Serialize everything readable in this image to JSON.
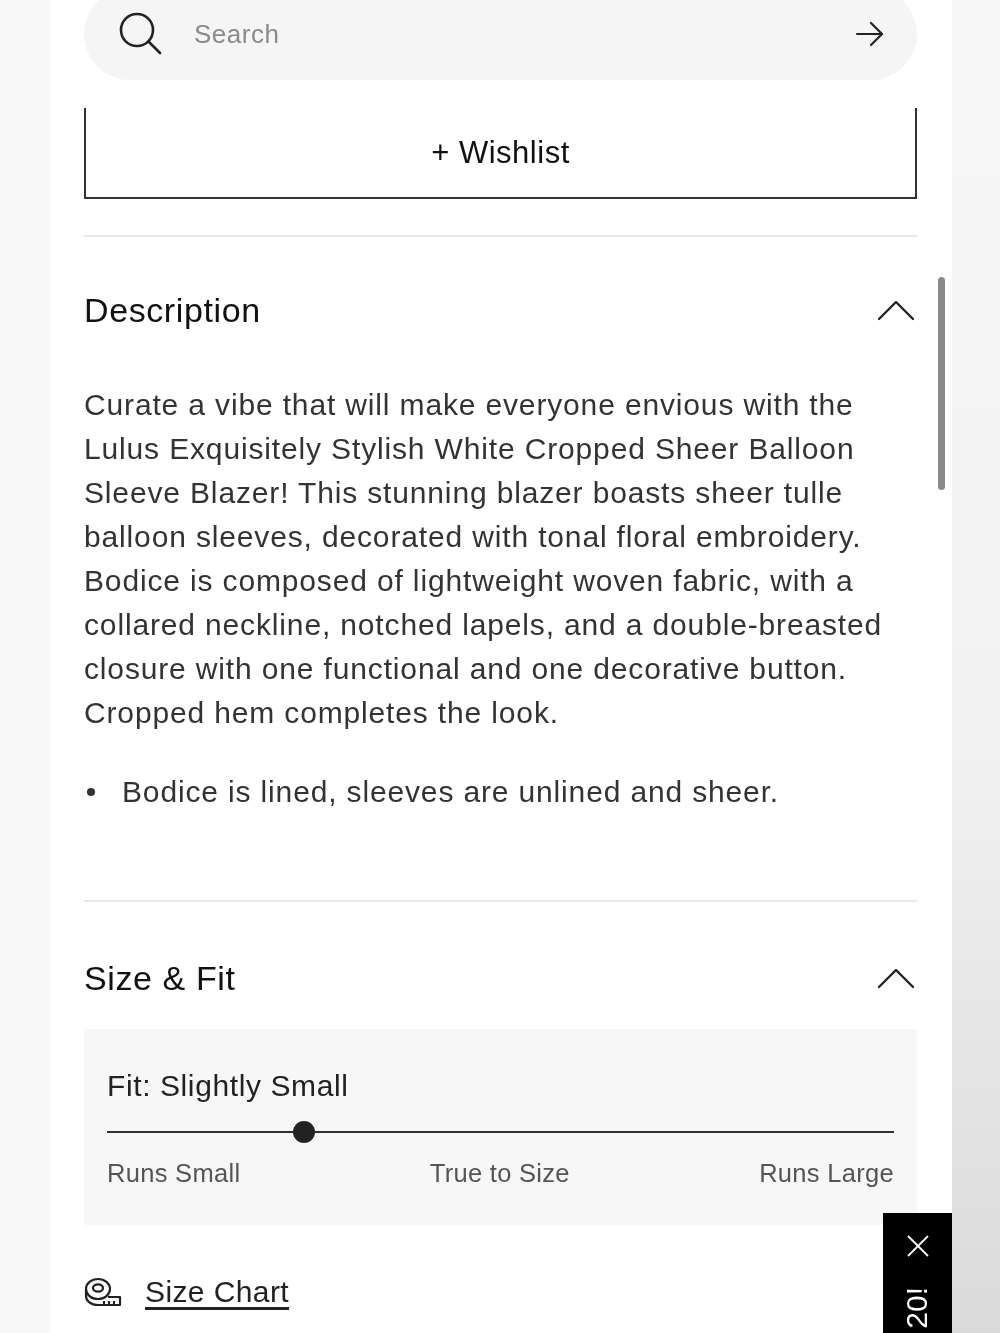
{
  "search": {
    "placeholder": "Search"
  },
  "wishlist_button": {
    "label": "+ Wishlist"
  },
  "sections": [
    {
      "title": "Description",
      "expanded": true,
      "paragraph": "Curate a vibe that will make everyone envious with the Lulus Exquisitely Stylish White Cropped Sheer Balloon Sleeve Blazer! This stunning blazer boasts sheer tulle balloon sleeves, decorated with tonal floral embroidery. Bodice is composed of lightweight woven fabric, with a collared neckline, notched lapels, and a double-breasted closure with one functional and one decorative button. Cropped hem completes the look.",
      "bullets": [
        "Bodice is lined, sleeves are unlined and sheer."
      ]
    },
    {
      "title": "Size & Fit",
      "expanded": true,
      "fit": {
        "label": "Fit: Slightly Small",
        "level": 0.25,
        "scale_labels": [
          "Runs Small",
          "True to Size",
          "Runs Large"
        ]
      },
      "size_chart_link": "Size Chart"
    }
  ],
  "promo_tab": {
    "text": "20!"
  }
}
